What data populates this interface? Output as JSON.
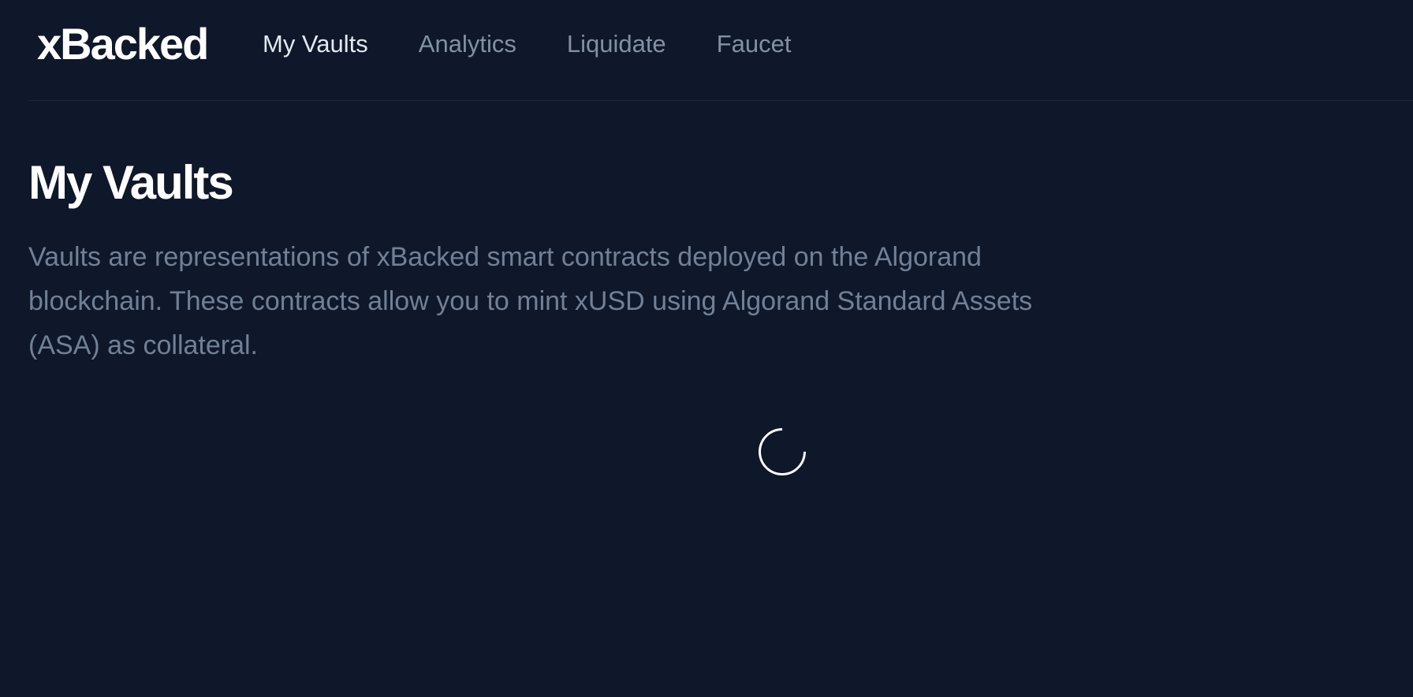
{
  "header": {
    "logo": "xBacked",
    "nav": [
      {
        "label": "My Vaults",
        "active": true
      },
      {
        "label": "Analytics",
        "active": false
      },
      {
        "label": "Liquidate",
        "active": false
      },
      {
        "label": "Faucet",
        "active": false
      }
    ]
  },
  "main": {
    "title": "My Vaults",
    "description": "Vaults are representations of xBacked smart contracts deployed on the Algorand blockchain. These contracts allow you to mint xUSD using Algorand Standard Assets (ASA) as collateral.",
    "loading_icon": "spinner-icon"
  },
  "colors": {
    "background": "#0f172a",
    "nav_inactive": "#8291a5",
    "nav_active": "#e2e8f0",
    "description": "#718096",
    "title": "#ffffff"
  }
}
